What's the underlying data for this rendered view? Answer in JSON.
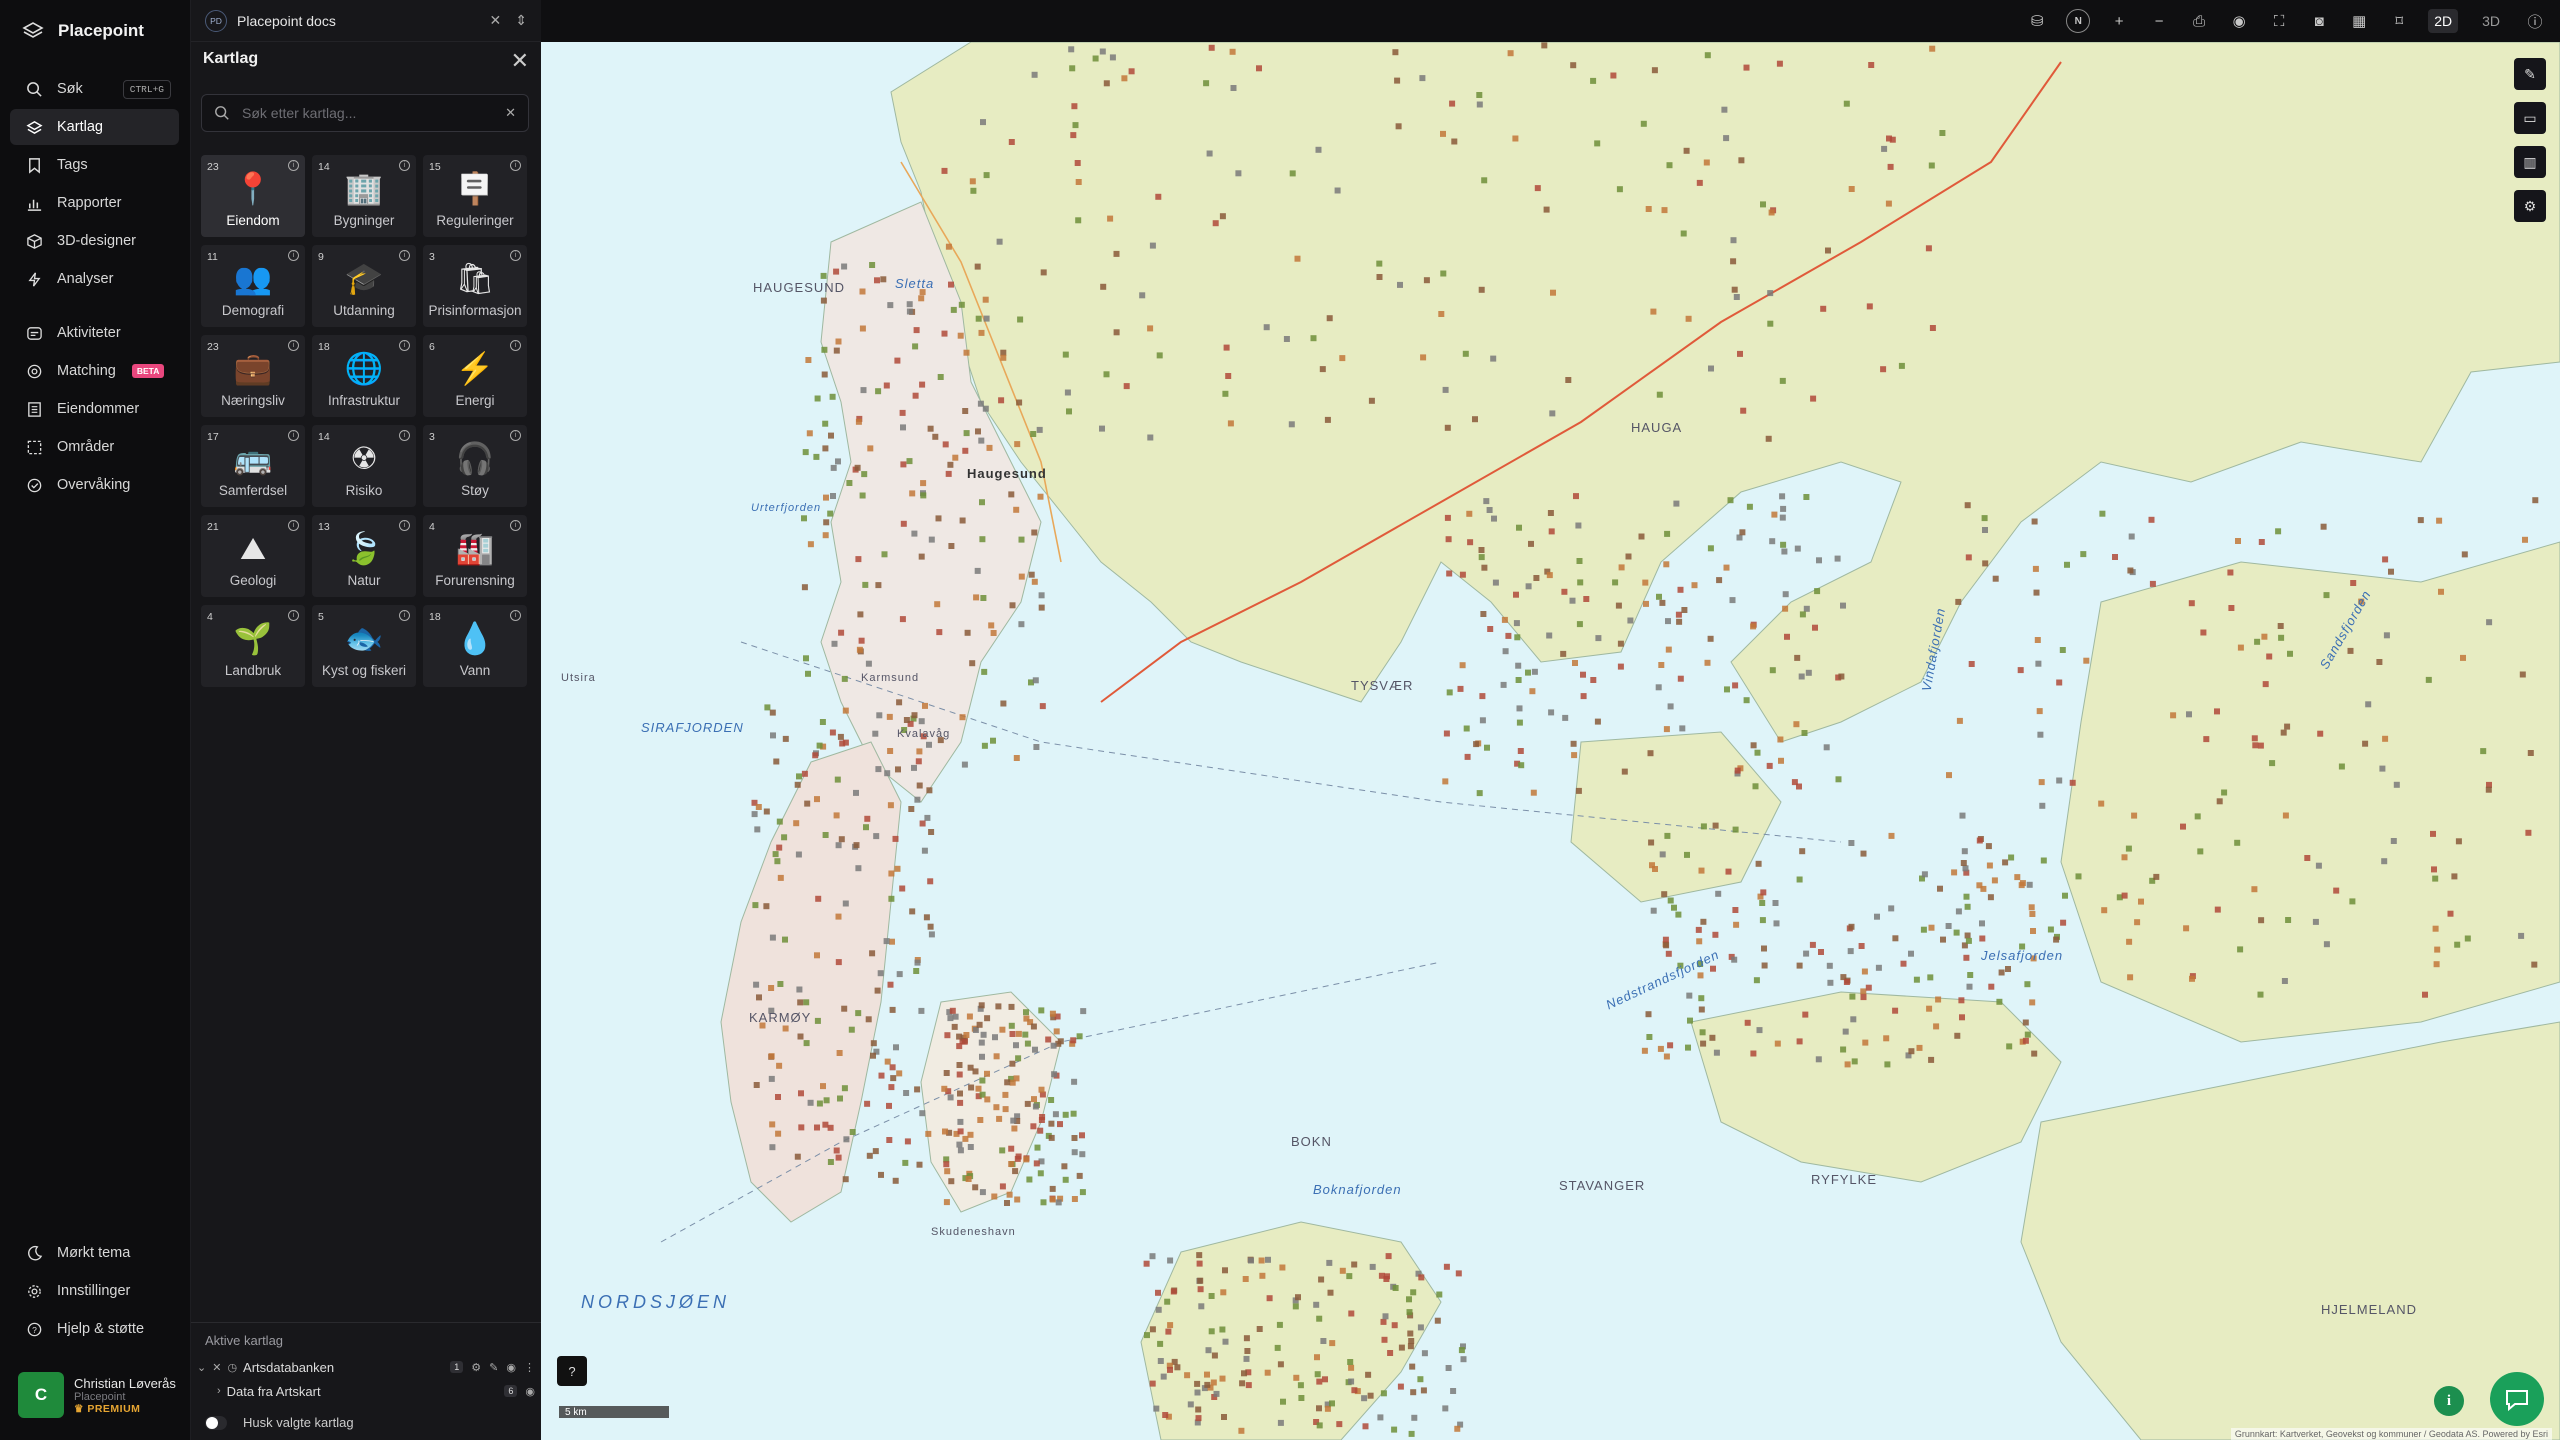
{
  "app": {
    "name": "Placepoint"
  },
  "nav": {
    "items": [
      {
        "label": "Søk",
        "shortcut": "CTRL+G"
      },
      {
        "label": "Kartlag"
      },
      {
        "label": "Tags"
      },
      {
        "label": "Rapporter"
      },
      {
        "label": "3D-designer"
      },
      {
        "label": "Analyser"
      },
      {
        "label": "Aktiviteter"
      },
      {
        "label": "Matching",
        "badge": "BETA"
      },
      {
        "label": "Eiendommer"
      },
      {
        "label": "Områder"
      },
      {
        "label": "Overvåking"
      }
    ],
    "bottom": [
      {
        "label": "Mørkt tema"
      },
      {
        "label": "Innstillinger"
      },
      {
        "label": "Hjelp & støtte"
      }
    ],
    "active": "Kartlag"
  },
  "user": {
    "initial": "C",
    "name": "Christian Løverås",
    "org": "Placepoint",
    "plan": "PREMIUM"
  },
  "tab": {
    "badge": "PD",
    "label": "Placepoint docs"
  },
  "panel": {
    "title": "Kartlag",
    "search_placeholder": "Søk etter kartlag...",
    "tiles": [
      {
        "count": "23",
        "label": "Eiendom",
        "icon": "📍"
      },
      {
        "count": "14",
        "label": "Bygninger",
        "icon": "🏢"
      },
      {
        "count": "15",
        "label": "Reguleringer",
        "icon": "🪧"
      },
      {
        "count": "11",
        "label": "Demografi",
        "icon": "👥"
      },
      {
        "count": "9",
        "label": "Utdanning",
        "icon": "🎓"
      },
      {
        "count": "3",
        "label": "Prisinformasjon",
        "icon": "🛍"
      },
      {
        "count": "23",
        "label": "Næringsliv",
        "icon": "💼"
      },
      {
        "count": "18",
        "label": "Infrastruktur",
        "icon": "🌐"
      },
      {
        "count": "6",
        "label": "Energi",
        "icon": "⚡"
      },
      {
        "count": "17",
        "label": "Samferdsel",
        "icon": "🚌"
      },
      {
        "count": "14",
        "label": "Risiko",
        "icon": "☢"
      },
      {
        "count": "3",
        "label": "Støy",
        "icon": "🎧"
      },
      {
        "count": "21",
        "label": "Geologi",
        "icon": "⛰"
      },
      {
        "count": "13",
        "label": "Natur",
        "icon": "🍃"
      },
      {
        "count": "4",
        "label": "Forurensning",
        "icon": "🏭"
      },
      {
        "count": "4",
        "label": "Landbruk",
        "icon": "🌱"
      },
      {
        "count": "5",
        "label": "Kyst og fiskeri",
        "icon": "🐟"
      },
      {
        "count": "18",
        "label": "Vann",
        "icon": "💧"
      }
    ],
    "active_title": "Aktive kartlag",
    "active_layer": {
      "name": "Artsdatabanken",
      "count": "1"
    },
    "sub_layer": {
      "name": "Data fra Artskart",
      "count": "6"
    },
    "remember_label": "Husk valgte kartlag"
  },
  "toolbar": {
    "compass": "N",
    "mode_2d": "2D",
    "mode_3d": "3D"
  },
  "map": {
    "labels": [
      {
        "text": "HAUGESUND"
      },
      {
        "text": "Haugesund"
      },
      {
        "text": "Sletta"
      },
      {
        "text": "SIRAFJORDEN"
      },
      {
        "text": "KARMØY"
      },
      {
        "text": "NORDSJØEN"
      },
      {
        "text": "TYSVÆR"
      },
      {
        "text": "BOKN"
      },
      {
        "text": "Boknafjorden"
      },
      {
        "text": "STAVANGER"
      },
      {
        "text": "RYFYLKE"
      },
      {
        "text": "Nedstrandsfjorden"
      },
      {
        "text": "Jelsafjorden"
      },
      {
        "text": "HAUGA"
      },
      {
        "text": "Vindafjorden"
      },
      {
        "text": "Sandsfjorden"
      },
      {
        "text": "HJELMELAND"
      },
      {
        "text": "Skudeneshavn"
      },
      {
        "text": "Utsira"
      },
      {
        "text": "Urterfjorden"
      },
      {
        "text": "Kvalavåg"
      },
      {
        "text": "Karmsund"
      }
    ],
    "scale": "5 km",
    "attribution": "Grunnkart: Kartverket, Geovekst og kommuner / Geodata AS. Powered by Esri"
  },
  "colors": {
    "accent": "#1aa05a",
    "beta": "#e9477e",
    "sea": "#dff4f9",
    "land": "#e8edc4"
  }
}
